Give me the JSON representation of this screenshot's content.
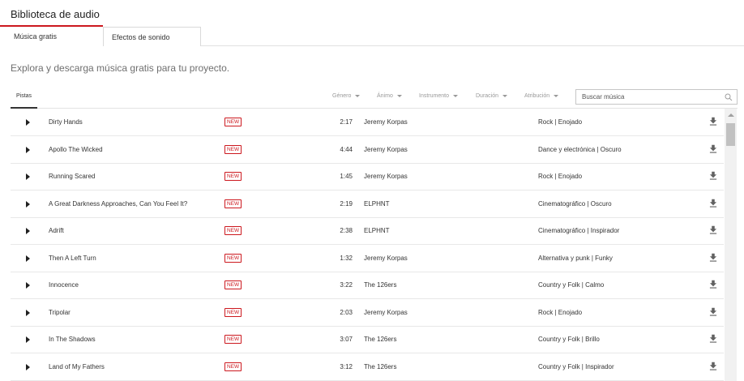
{
  "app": {
    "title": "Biblioteca de audio"
  },
  "tabs": [
    {
      "label": "Música gratis",
      "active": true
    },
    {
      "label": "Efectos de sonido",
      "active": false
    }
  ],
  "subtitle": "Explora y descarga música gratis para tu proyecto.",
  "toolbar": {
    "tracks_tab": "Pistas",
    "filters": [
      "Género",
      "Ánimo",
      "Instrumento",
      "Duración",
      "Atribución"
    ],
    "search_placeholder": "Buscar música"
  },
  "badge_label": "NEW",
  "tracks": [
    {
      "title": "Dirty Hands",
      "duration": "2:17",
      "artist": "Jeremy Korpas",
      "genre": "Rock | Enojado"
    },
    {
      "title": "Apollo The Wicked",
      "duration": "4:44",
      "artist": "Jeremy Korpas",
      "genre": "Dance y electrónica | Oscuro"
    },
    {
      "title": "Running Scared",
      "duration": "1:45",
      "artist": "Jeremy Korpas",
      "genre": "Rock | Enojado"
    },
    {
      "title": "A Great Darkness Approaches, Can You Feel It?",
      "duration": "2:19",
      "artist": "ELPHNT",
      "genre": "Cinematográfico | Oscuro"
    },
    {
      "title": "Adrift",
      "duration": "2:38",
      "artist": "ELPHNT",
      "genre": "Cinematográfico | Inspirador"
    },
    {
      "title": "Then A Left Turn",
      "duration": "1:32",
      "artist": "Jeremy Korpas",
      "genre": "Alternativa y punk | Funky"
    },
    {
      "title": "Innocence",
      "duration": "3:22",
      "artist": "The 126ers",
      "genre": "Country y Folk | Calmo"
    },
    {
      "title": "Tripolar",
      "duration": "2:03",
      "artist": "Jeremy Korpas",
      "genre": "Rock | Enojado"
    },
    {
      "title": "In The Shadows",
      "duration": "3:07",
      "artist": "The 126ers",
      "genre": "Country y Folk | Brillo"
    },
    {
      "title": "Land of My Fathers",
      "duration": "3:12",
      "artist": "The 126ers",
      "genre": "Country y Folk | Inspirador"
    }
  ],
  "colors": {
    "accent": "#cc181e",
    "text": "#212121",
    "muted": "#999999"
  },
  "icons": {
    "play": "play-icon",
    "download": "download-icon",
    "search": "search-icon"
  }
}
